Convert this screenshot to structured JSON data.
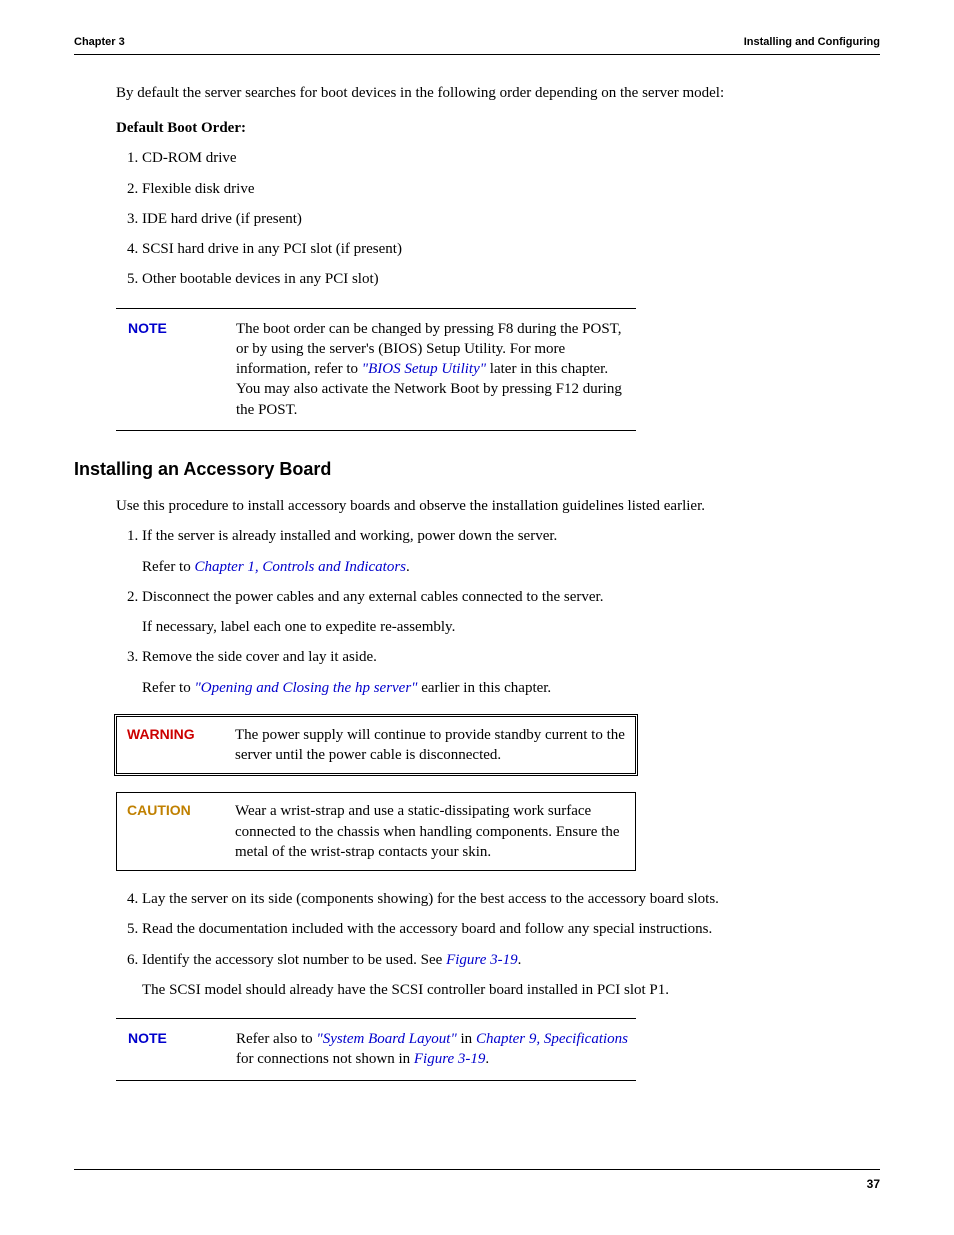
{
  "header": {
    "left": "Chapter 3",
    "right": "Installing and Configuring"
  },
  "intro": "By default the server searches for boot devices in the following order depending on the server model:",
  "boot_order_heading": "Default Boot Order:",
  "boot_items": [
    "CD-ROM drive",
    "Flexible disk drive",
    "IDE hard drive (if present)",
    "SCSI hard drive in any PCI slot (if present)",
    "Other bootable devices in any PCI slot)"
  ],
  "note1": {
    "label": "NOTE",
    "pre": "The boot order can be changed by pressing F8 during the POST, or by using the server's (BIOS) Setup Utility. For more information, refer to ",
    "link": "\"BIOS Setup Utility\"",
    "post": " later in this chapter. You may also activate the Network Boot by pressing F12 during the POST."
  },
  "section_title": "Installing an Accessory Board",
  "section_intro": "Use this procedure to install accessory boards and observe the installation guidelines listed earlier.",
  "steps_a": [
    {
      "text": "If the server is already installed and working, power down the server.",
      "sub_pre": "Refer to ",
      "sub_link": "Chapter 1, Controls and Indicators",
      "sub_post": "."
    },
    {
      "text": "Disconnect the power cables and any external cables connected to the server.",
      "sub_plain": "If necessary, label each one to expedite re-assembly."
    },
    {
      "text": "Remove the side cover and lay it aside.",
      "sub_pre": "Refer to ",
      "sub_link": "\"Opening and Closing the hp server\"",
      "sub_post": "  earlier in this chapter."
    }
  ],
  "warning": {
    "label": "WARNING",
    "text": "The power supply will continue to provide standby current to the server until the power cable is disconnected."
  },
  "caution": {
    "label": "CAUTION",
    "text": "Wear a wrist-strap and use a static-dissipating work surface connected to the chassis when handling components. Ensure the metal of the wrist-strap contacts your skin."
  },
  "steps_b": [
    "Lay the server on its side (components showing) for the best access to the accessory board slots.",
    "Read the documentation included with the accessory board and follow any special instructions."
  ],
  "step6": {
    "text_pre": "Identify the accessory slot number to be used. See ",
    "link": "Figure 3-19",
    "text_post": ".",
    "sub": "The SCSI model should already have the SCSI controller board installed in PCI slot P1."
  },
  "note2": {
    "label": "NOTE",
    "pre": "Refer also to ",
    "link1": "\"System Board Layout\"",
    "mid1": "  in ",
    "link2": "Chapter 9, Specifications",
    "mid2": " for connections not shown in ",
    "link3": "Figure 3-19",
    "post": "."
  },
  "page_number": "37"
}
